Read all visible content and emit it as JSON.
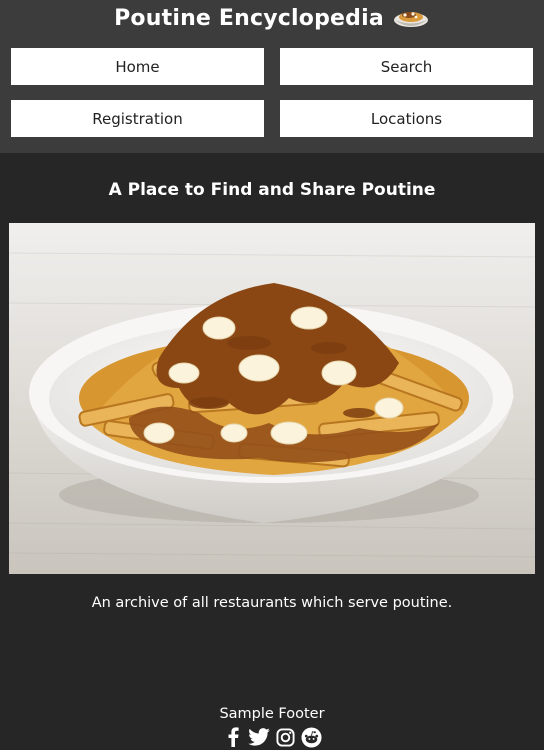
{
  "header": {
    "title": "Poutine Encyclopedia"
  },
  "nav": {
    "home": "Home",
    "search": "Search",
    "registration": "Registration",
    "locations": "Locations"
  },
  "main": {
    "tagline": "A Place to Find and Share Poutine",
    "description": "An archive of all restaurants which serve poutine."
  },
  "footer": {
    "text": "Sample Footer",
    "social_icons": [
      "facebook-icon",
      "twitter-icon",
      "instagram-icon",
      "reddit-icon"
    ]
  },
  "colors": {
    "page_background": "#262626",
    "header_background": "#3c3c3c",
    "button_background": "#ffffff",
    "text": "#ffffff"
  }
}
